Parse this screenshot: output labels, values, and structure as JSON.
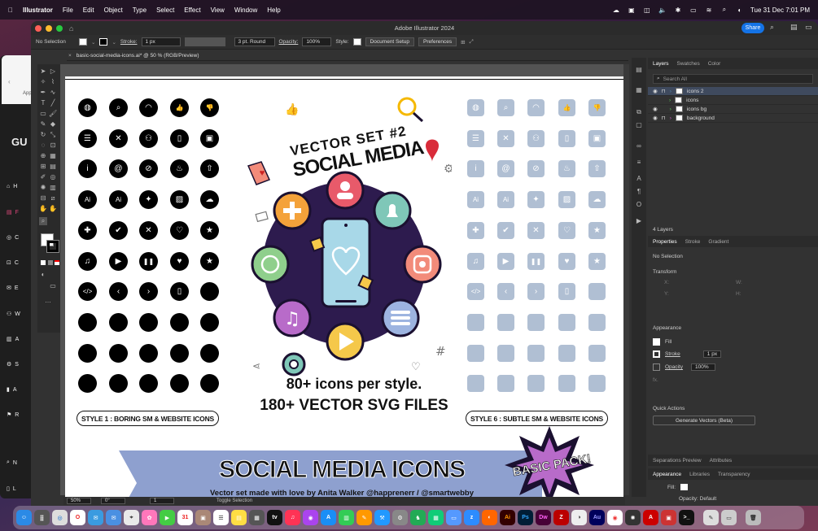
{
  "menubar": {
    "app": "Illustrator",
    "items": [
      "File",
      "Edit",
      "Object",
      "Type",
      "Select",
      "Effect",
      "View",
      "Window",
      "Help"
    ],
    "clock": "Tue 31 Dec  7:01 PM"
  },
  "window": {
    "title": "Adobe Illustrator 2024",
    "share": "Share"
  },
  "control": {
    "selection": "No Selection",
    "stroke_label": "Stroke:",
    "stroke_value": "1 px",
    "brush": "3 pt. Round",
    "opacity_label": "Opacity:",
    "opacity_value": "100%",
    "style_label": "Style:",
    "doc_setup": "Document Setup",
    "preferences": "Preferences"
  },
  "doc_tab": "basic-social-media-icons.ai* @ 50 % (RGB/Preview)",
  "status": {
    "zoom": "50%",
    "rotation": "0°",
    "artboard": "1",
    "tool": "Toggle Selection"
  },
  "layers_panel": {
    "tabs": [
      "Layers",
      "Swatches",
      "Color"
    ],
    "search_placeholder": "Search All",
    "layers": [
      "icons 2",
      "icons",
      "icons bg",
      "background"
    ],
    "count": "4 Layers"
  },
  "properties": {
    "tabs": [
      "Properties",
      "Stroke",
      "Gradient"
    ],
    "selection": "No Selection",
    "transform": "Transform",
    "x": "X:",
    "y": "Y:",
    "w": "W:",
    "h": "H:",
    "appearance": "Appearance",
    "fill": "Fill",
    "stroke": "Stroke",
    "stroke_value": "1 px",
    "opacity": "Opacity",
    "opacity_value": "100%",
    "fx": "fx.",
    "quick_actions": "Quick Actions",
    "generate": "Generate Vectors (Beta)"
  },
  "bottom_panel": {
    "tabs1": [
      "Separations Preview",
      "Attributes"
    ],
    "tabs2": [
      "Appearance",
      "Libraries",
      "Transparency"
    ],
    "fill_label": "Fill:",
    "op1": "Opacity: Default",
    "op2": "Opacity: Default"
  },
  "artwork": {
    "vector_set": "VECTOR SET #2",
    "social_media": "SOCIAL MEDIA",
    "icons_per_style": "80+ icons per style.",
    "svg_files": "180+ VECTOR SVG FILES",
    "style1": "STYLE 1 : BORING SM & WEBSITE ICONS",
    "style6": "STYLE 6 : SUBTLE SM & WEBSITE ICONS",
    "banner_title": "SOCIAL MEDIA ICONS",
    "banner_sub": "Vector set made with love by Anita Walker @happrenerr / @smartwebby",
    "badge": "BASIC PACK!"
  },
  "colors": {
    "accent": "#1473e6",
    "subtle_icon": "#b0bfd3",
    "phone": "#a8d8e8",
    "circle": "#2d1b4e",
    "banner": "#8ea0cf"
  },
  "sidebar_partial": [
    "H",
    "F",
    "C",
    "C",
    "E",
    "W",
    "A",
    "S",
    "A",
    "R",
    "N",
    "L"
  ],
  "left_partial": {
    "text": "GU",
    "app": "App"
  }
}
